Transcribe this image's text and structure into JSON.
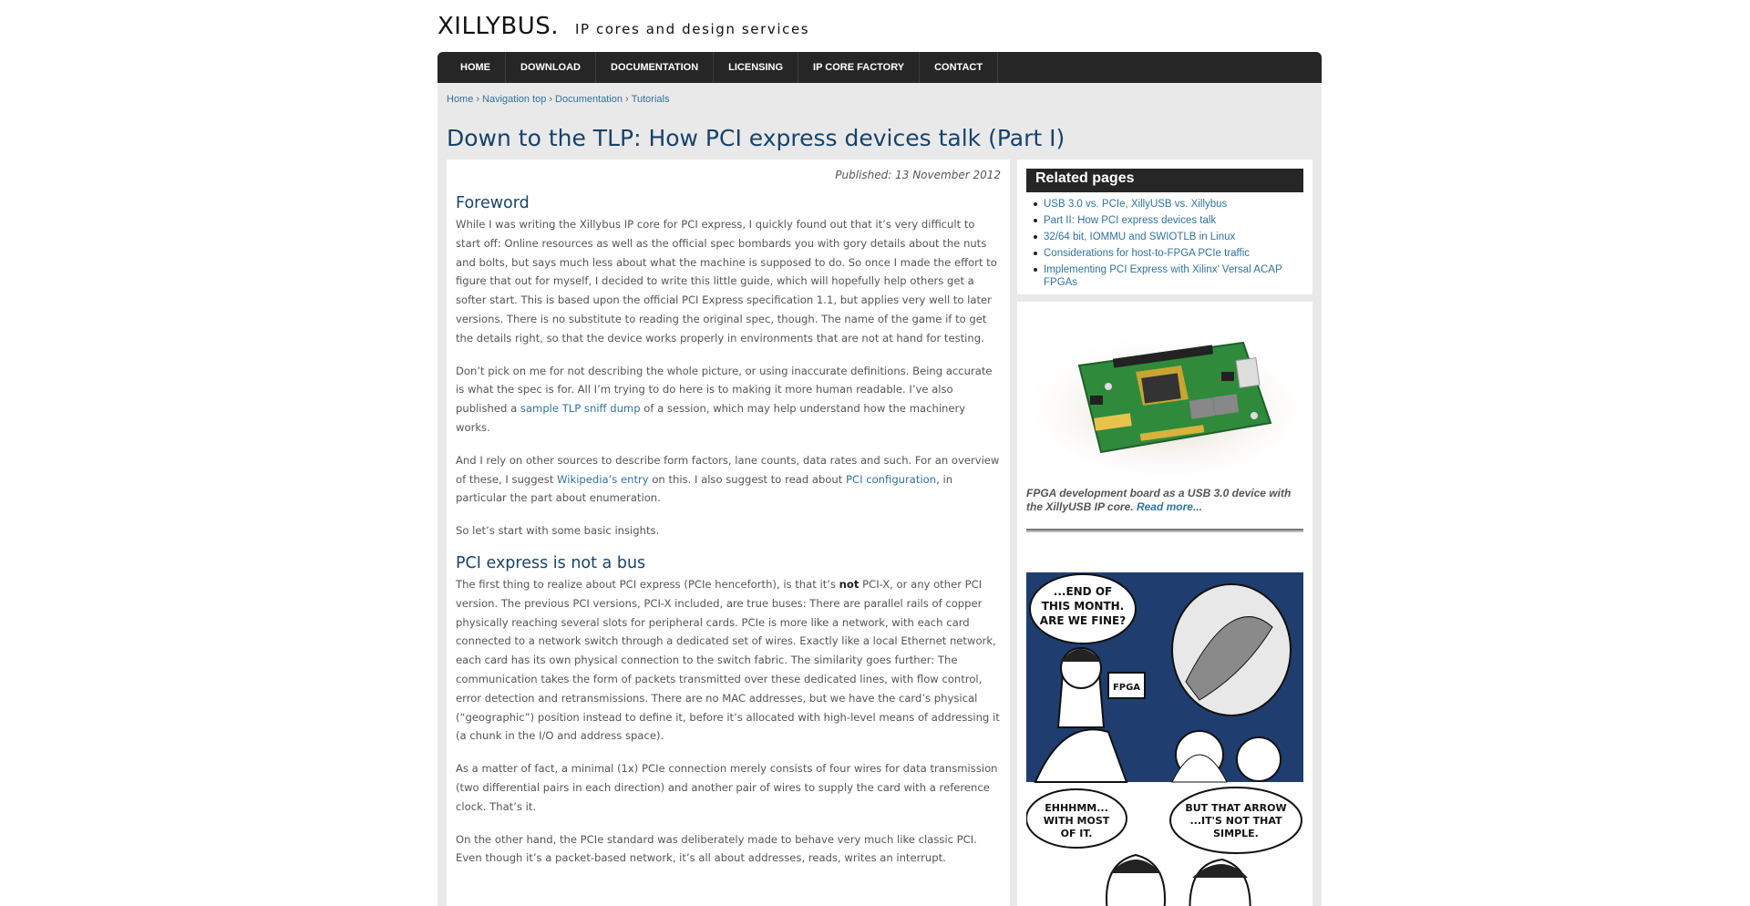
{
  "header": {
    "logo": "XILLYBUS.",
    "tagline": "IP cores and design services"
  },
  "nav": {
    "items": [
      "HOME",
      "DOWNLOAD",
      "DOCUMENTATION",
      "LICENSING",
      "IP CORE FACTORY",
      "CONTACT"
    ]
  },
  "breadcrumb": {
    "items": [
      "Home",
      "Navigation top",
      "Documentation",
      "Tutorials"
    ],
    "separator": "›"
  },
  "page_title": "Down to the TLP: How PCI express devices talk (Part I)",
  "article": {
    "published": "Published: 13 November 2012",
    "section1_title": "Foreword",
    "p1": "While I was writing the Xillybus IP core for PCI express, I quickly found out that it’s very difficult to start off: Online resources as well as the official spec bombards you with gory details about the nuts and bolts, but says much less about what the machine is supposed to do. So once I made the effort to figure that out for myself, I decided to write this little guide, which will hopefully help others get a softer start. This is based upon the official PCI Express specification 1.1, but applies very well to later versions. There is no substitute to reading the original spec, though. The name of the game if to get the details right, so that the device works properly in environments that are not at hand for testing.",
    "p2_before": "Don’t pick on me for not describing the whole picture, or using inaccurate definitions. Being accurate is what the spec is for. All I’m trying to do here is to making it more human readable. I’ve also published a ",
    "p2_link": "sample TLP sniff dump",
    "p2_after": " of a session, which may help understand how the machinery works.",
    "p3_before": "And I rely on other sources to describe form factors, lane counts, data rates and such. For an overview of these, I suggest ",
    "p3_link1": "Wikipedia’s entry",
    "p3_mid": " on this. I also suggest to read about ",
    "p3_link2": "PCI configuration",
    "p3_after": ", in particular the part about enumeration.",
    "p4": "So let’s start with some basic insights.",
    "section2_title": "PCI express is not a bus",
    "p5_before": "The first thing to realize about PCI express (PCIe henceforth), is that it’s ",
    "p5_bold": "not",
    "p5_after": " PCI-X, or any other PCI version. The previous PCI versions, PCI-X included, are true buses: There are parallel rails of copper physically reaching several slots for peripheral cards. PCIe is more like a network, with each card connected to a network switch through a dedicated set of wires. Exactly like a local Ethernet network, each card has its own physical connection to the switch fabric. The similarity goes further: The communication takes the form of packets transmitted over these dedicated lines, with flow control, error detection and retransmissions. There are no MAC addresses, but we have the card’s physical (“geographic”) position instead to define it, before it’s allocated with high-level means of addressing it (a chunk in the I/O and address space).",
    "p6": "As a matter of fact, a minimal (1x) PCIe connection merely consists of four wires for data transmission (two differential pairs in each direction) and another pair of wires to supply the card with a reference clock. That’s it.",
    "p7": "On the other hand, the PCIe standard was deliberately made to behave very much like classic PCI. Even though it’s a packet-based network, it’s all about addresses, reads, writes an interrupt."
  },
  "sidebar": {
    "related_title": "Related pages",
    "related": [
      "USB 3.0 vs. PCIe, XillyUSB vs. Xillybus",
      "Part II: How PCI express devices talk",
      "32/64 bit, IOMMU and SWIOTLB in Linux",
      "Considerations for host-to-FPGA PCIe traffic",
      "Implementing PCI Express with Xilinx’ Versal ACAP FPGAs"
    ],
    "caption_text": "FPGA development board as a USB 3.0 device with the XillyUSB IP core.",
    "caption_link": "Read more...",
    "comic_text": [
      "...END OF THIS MONTH. ARE WE FINE?",
      "FPGA",
      "EHHHMM... WITH MOST OF IT.",
      "BUT THAT ARROW ...IT'S NOT THAT SIMPLE."
    ]
  },
  "colors": {
    "nav_bg": "#262626",
    "title": "#17436b",
    "link": "#31739c",
    "page_bg": "#e9e9e9"
  }
}
